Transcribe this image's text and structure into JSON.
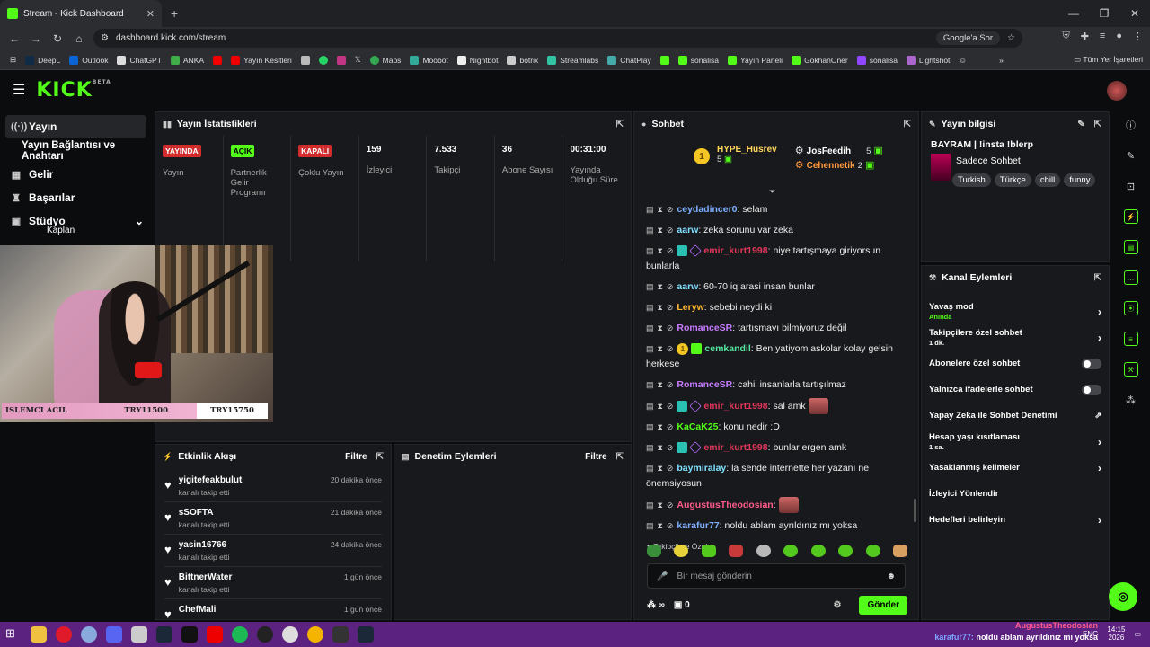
{
  "browser": {
    "tab_title": "Stream - Kick Dashboard",
    "url": "dashboard.kick.com/stream",
    "google_btn": "Google'a Sor",
    "bookmarks": [
      "DeepL",
      "Outlook",
      "ChatGPT",
      "ANKA",
      "",
      "Yayın Kesitleri",
      "",
      "",
      "",
      "",
      "Maps",
      "Moobot",
      "Nightbot",
      "botrix",
      "Streamlabs",
      "ChatPlay",
      "",
      "sonalisa",
      "Yayın Paneli",
      "GokhanOner",
      "sonalisa",
      "Lightshot"
    ],
    "bookmarks_all": "Tüm Yer İşaretleri"
  },
  "header": {
    "logo": "KICK",
    "beta": "BETA"
  },
  "sidebar": {
    "items": [
      {
        "label": "Yayın",
        "icon": "broadcast-icon"
      },
      {
        "label": "Yayın Bağlantısı ve Anahtarı"
      },
      {
        "label": "Gelir",
        "icon": "money-icon"
      },
      {
        "label": "Başarılar",
        "icon": "trophy-icon"
      },
      {
        "label": "Stüdyo",
        "icon": "studio-icon"
      }
    ]
  },
  "stats_panel": {
    "title": "Yayın İstatistikleri",
    "stats": [
      {
        "badge": "YAYINDA",
        "label": "Yayın"
      },
      {
        "badge": "AÇIK",
        "label": "Partnerlik Gelir Programı"
      },
      {
        "badge": "KAPALI",
        "label": "Çoklu Yayın"
      },
      {
        "value": "159",
        "label": "İzleyici"
      },
      {
        "value": "7.533",
        "label": "Takipçi"
      },
      {
        "value": "36",
        "label": "Abone Sayısı"
      },
      {
        "value": "00:31:00",
        "label": "Yayında Olduğu Süre"
      }
    ]
  },
  "webcam": {
    "overlay_name": "Kaplan",
    "donation_left": "ISLEMCI ACIL",
    "donation_mid": "TRY11500",
    "donation_right": "TRY15750"
  },
  "activity": {
    "title": "Etkinlik Akışı",
    "filter": "Filtre",
    "items": [
      {
        "name": "yigitefeakbulut",
        "sub": "kanalı takip etti",
        "time": "20 dakika önce"
      },
      {
        "name": "sSOFTA",
        "sub": "kanalı takip etti",
        "time": "21 dakika önce"
      },
      {
        "name": "yasin16766",
        "sub": "kanalı takip etti",
        "time": "24 dakika önce"
      },
      {
        "name": "BittnerWater",
        "sub": "kanalı takip etti",
        "time": "1 gün önce"
      },
      {
        "name": "ChefMali",
        "sub": "",
        "time": "1 gün önce"
      }
    ]
  },
  "moderation": {
    "title": "Denetim Eylemleri",
    "filter": "Filtre"
  },
  "chat": {
    "title": "Sohbet",
    "pinned": {
      "coin": "1",
      "user1": "HYPE_Husrev",
      "count1": "5",
      "user2": "JosFeedih",
      "count2": "5",
      "user3": "Cehennetik",
      "count3": "2"
    },
    "messages": [
      {
        "user": "ceydadincer0",
        "color": "#7fb0ff",
        "text": ": selam"
      },
      {
        "user": "aarw",
        "color": "#7fe0ff",
        "text": ": zeka sorunu var zeka"
      },
      {
        "user": "emir_kurt1998",
        "color": "#e0365a",
        "text": ": niye tartışmaya giriyorsun bunlarla",
        "badges": true
      },
      {
        "user": "aarw",
        "color": "#7fe0ff",
        "text": ": 60-70 iq arasi insan bunlar"
      },
      {
        "user": "Leryw",
        "color": "#ffb830",
        "text": ": sebebi neydi ki"
      },
      {
        "user": "RomanceSR",
        "color": "#c87cff",
        "text": ": tartışmayı bilmiyoruz değil"
      },
      {
        "user": "cemkandil",
        "color": "#53e8a0",
        "text": ": Ben yatiyom askolar kolay gelsin herkese",
        "coin": "1"
      },
      {
        "user": "RomanceSR",
        "color": "#c87cff",
        "text": ": cahil insanlarla tartışılmaz"
      },
      {
        "user": "emir_kurt1998",
        "color": "#e0365a",
        "text": ": sal amk",
        "badges": true,
        "emote": true
      },
      {
        "user": "KaCaK25",
        "color": "#53fc18",
        "text": ": konu nedir :D"
      },
      {
        "user": "emir_kurt1998",
        "color": "#e0365a",
        "text": ": bunlar ergen amk",
        "badges": true
      },
      {
        "user": "baymiralay",
        "color": "#7fe0ff",
        "text": ": la sende internette her yazanı ne önemsiyosun"
      },
      {
        "user": "AugustusTheodosian",
        "color": "#ff5c8a",
        "text": ":",
        "emote": true
      },
      {
        "user": "karafur77",
        "color": "#7fb0ff",
        "text": ": noldu ablam ayrıldınız mı yoksa"
      }
    ],
    "followers_only": "Takipçilere Özel",
    "placeholder": "Bir mesaj gönderin",
    "infinity": "∞",
    "gift_count": "0",
    "send": "Gönder"
  },
  "stream_info": {
    "title": "Yayın bilgisi",
    "stream_title": "BAYRAM | !insta !blerp",
    "category": "Sadece Sohbet",
    "tags": [
      "Turkish",
      "Türkçe",
      "chill",
      "funny"
    ]
  },
  "channel_actions": {
    "title": "Kanal Eylemleri",
    "items": [
      {
        "label": "Yavaş mod",
        "sub": "Anında",
        "type": "arrow"
      },
      {
        "label": "Takipçilere özel sohbet",
        "sub": "1 dk.",
        "type": "arrow"
      },
      {
        "label": "Abonelere özel sohbet",
        "type": "toggle"
      },
      {
        "label": "Yalnızca ifadelerle sohbet",
        "type": "toggle"
      },
      {
        "label": "Yapay Zeka ile Sohbet Denetimi",
        "type": "ext"
      },
      {
        "label": "Hesap yaşı kısıtlaması",
        "sub": "1 sa.",
        "type": "arrow"
      },
      {
        "label": "Yasaklanmış kelimeler",
        "type": "arrow"
      },
      {
        "label": "İzleyici Yönlendir",
        "type": "none"
      },
      {
        "label": "Hedefleri belirleyin",
        "type": "arrow"
      }
    ]
  },
  "taskbar": {
    "lang": "ENG",
    "time": "14:15",
    "date": "2026"
  },
  "overlay_chat": {
    "user1": "AugustusTheodosian",
    "user2": "karafur77:",
    "text2": "noldu ablam ayrıldınız mı yoksa"
  }
}
